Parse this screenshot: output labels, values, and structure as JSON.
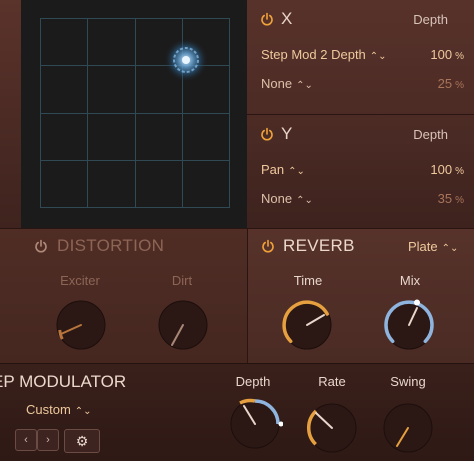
{
  "xy": {
    "x": {
      "letter": "X",
      "depth_label": "Depth",
      "rows": [
        {
          "source": "Step Mod 2 Depth",
          "value": "100",
          "unit": "%"
        },
        {
          "source": "None",
          "value": "25",
          "unit": "%"
        }
      ]
    },
    "y": {
      "letter": "Y",
      "depth_label": "Depth",
      "rows": [
        {
          "source": "Pan",
          "value": "100",
          "unit": "%"
        },
        {
          "source": "None",
          "value": "35",
          "unit": "%"
        }
      ]
    }
  },
  "distortion": {
    "title": "DISTORTION",
    "knobs": [
      {
        "label": "Exciter"
      },
      {
        "label": "Dirt"
      }
    ]
  },
  "reverb": {
    "title": "REVERB",
    "type": "Plate",
    "knobs": [
      {
        "label": "Time"
      },
      {
        "label": "Mix"
      }
    ]
  },
  "step_modulator": {
    "title": "EP MODULATOR",
    "preset": "Custom",
    "prev_icon": "chevron-left-icon",
    "next_icon": "chevron-right-icon",
    "settings_icon": "gear-icon",
    "knobs": [
      {
        "label": "Depth"
      },
      {
        "label": "Rate"
      },
      {
        "label": "Swing"
      }
    ]
  },
  "colors": {
    "accent_orange": "#e39a3d",
    "accent_blue": "#8fb4de",
    "panel_dark": "#2a1714"
  }
}
